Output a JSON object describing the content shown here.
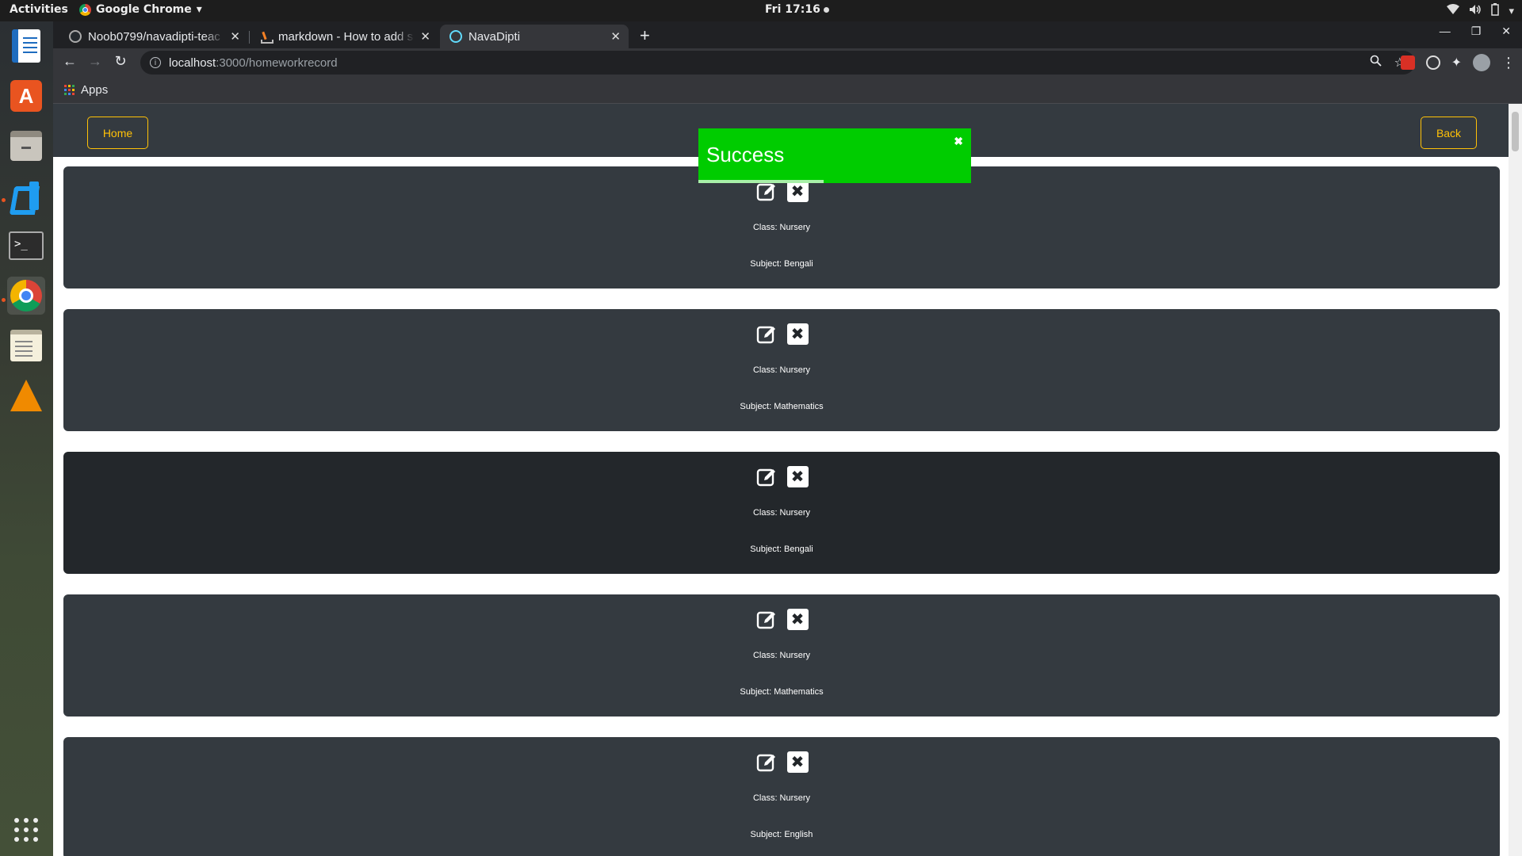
{
  "system_bar": {
    "activities": "Activities",
    "app_name": "Google Chrome",
    "clock": "Fri 17:16"
  },
  "browser": {
    "tabs": [
      {
        "title": "Noob0799/navadipti-teac",
        "icon": "github-icon",
        "active": false
      },
      {
        "title": "markdown - How to add s",
        "icon": "stackoverflow-icon",
        "active": false
      },
      {
        "title": "NavaDipti",
        "icon": "react-icon",
        "active": true
      }
    ],
    "url": {
      "host": "localhost",
      "path": ":3000/homeworkrecord"
    },
    "bookmarks": {
      "apps_label": "Apps"
    }
  },
  "page": {
    "nav": {
      "home_label": "Home",
      "back_label": "Back"
    },
    "toast": {
      "message": "Success",
      "close": "✖",
      "color": "#00cc00",
      "progress": 0.46
    },
    "records": [
      {
        "class_text": "Class: Nursery",
        "subject_text": "Subject: Bengali"
      },
      {
        "class_text": "Class: Nursery",
        "subject_text": "Subject: Mathematics"
      },
      {
        "class_text": "Class: Nursery",
        "subject_text": "Subject: Bengali"
      },
      {
        "class_text": "Class: Nursery",
        "subject_text": "Subject: Mathematics"
      },
      {
        "class_text": "Class: Nursery",
        "subject_text": "Subject: English"
      }
    ],
    "colors": {
      "navbar": "#343a40",
      "accent": "#ffc107",
      "card": "#343a40",
      "card_hover": "#23272b"
    }
  }
}
